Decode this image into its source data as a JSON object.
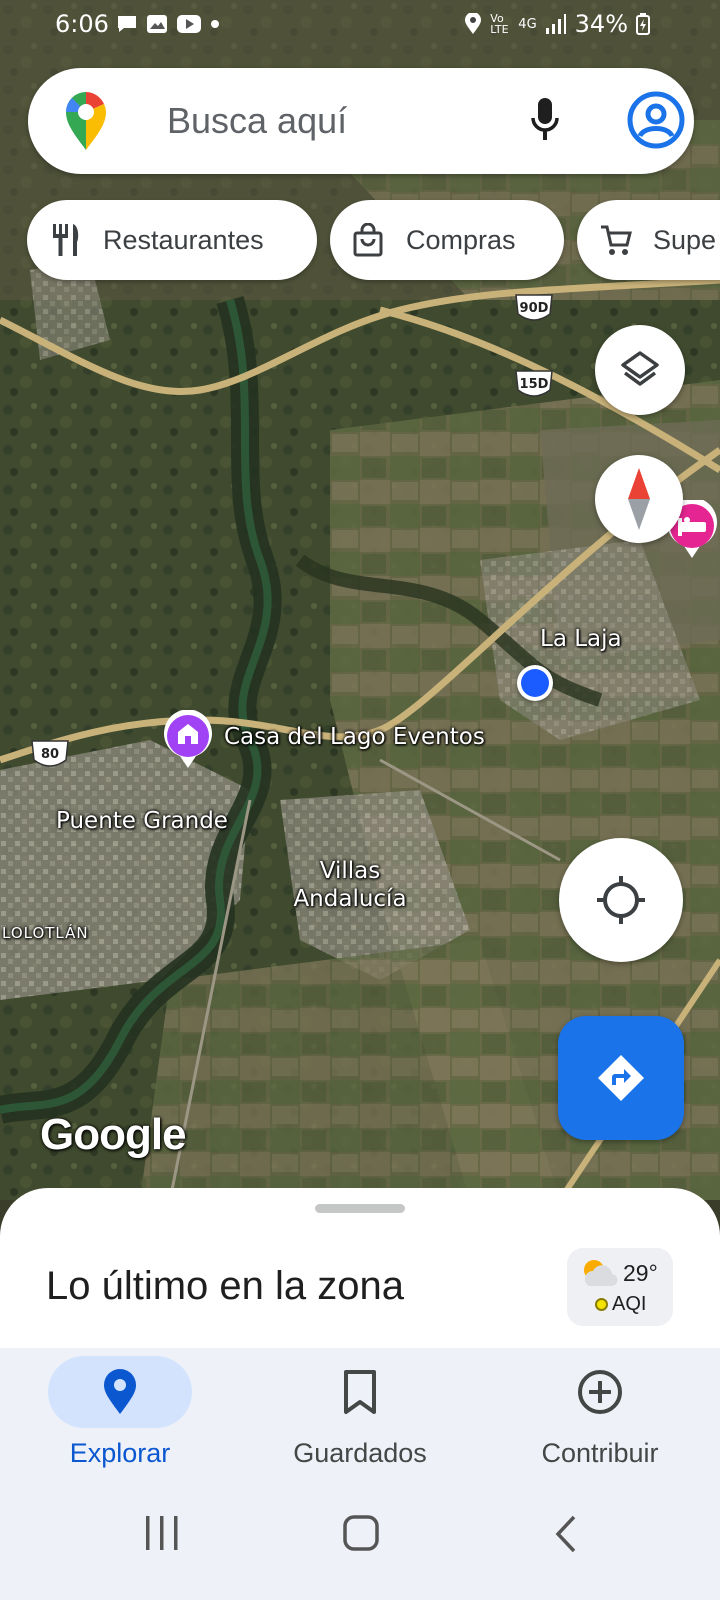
{
  "status_bar": {
    "time": "6:06",
    "battery": "34%",
    "network": "4G",
    "volte": "Vo LTE"
  },
  "search": {
    "placeholder": "Busca aquí"
  },
  "chips": [
    {
      "label": "Restaurantes",
      "icon": "utensils-icon"
    },
    {
      "label": "Compras",
      "icon": "shopping-bag-icon"
    },
    {
      "label": "Supe",
      "icon": "shopping-cart-icon"
    }
  ],
  "map": {
    "labels": {
      "la_laja": "La Laja",
      "casa_del_lago": "Casa del Lago Eventos",
      "puente_grande": "Puente Grande",
      "villas_andalucia_line1": "Villas",
      "villas_andalucia_line2": "Andalucía",
      "lolotlan": "LOLOTLÁN"
    },
    "road_shields": [
      "90D",
      "15D",
      "80"
    ],
    "logo": "Google"
  },
  "controls": {
    "layers": "layers-icon",
    "compass": "compass-icon",
    "my_location": "my-location-icon",
    "directions": "directions-icon"
  },
  "sheet": {
    "title": "Lo último en la zona",
    "weather": {
      "temperature": "29°",
      "aqi_label": "AQI"
    }
  },
  "bottom_nav": [
    {
      "label": "Explorar",
      "icon": "explore-pin-icon",
      "active": true
    },
    {
      "label": "Guardados",
      "icon": "bookmark-icon",
      "active": false
    },
    {
      "label": "Contribuir",
      "icon": "add-circle-icon",
      "active": false
    }
  ],
  "colors": {
    "accent": "#1a73e8",
    "active_nav_text": "#0b57d0",
    "active_nav_pill": "#d3e3fd",
    "place_pin": "#a142f4",
    "hotel_pin": "#e52592"
  }
}
